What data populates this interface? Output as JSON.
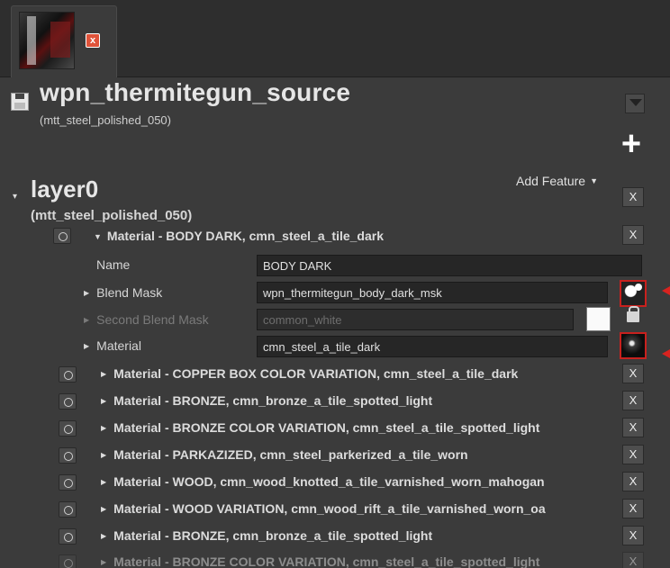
{
  "tab": {
    "close": "x"
  },
  "source": {
    "title": "wpn_thermitegun_source",
    "subtitle": "(mtt_steel_polished_050)",
    "add": "+"
  },
  "layer": {
    "title": "layer0",
    "subtitle": "(mtt_steel_polished_050)",
    "add_feature": "Add Feature",
    "close": "X"
  },
  "material_open": {
    "header": "Material - BODY DARK, cmn_steel_a_tile_dark",
    "close": "X",
    "props": {
      "name_label": "Name",
      "name_value": "BODY DARK",
      "blend_mask_label": "Blend Mask",
      "blend_mask_value": "wpn_thermitegun_body_dark_msk",
      "second_blend_mask_label": "Second Blend Mask",
      "second_blend_mask_value": "common_white",
      "material_label": "Material",
      "material_value": "cmn_steel_a_tile_dark"
    }
  },
  "materials": [
    {
      "label": "Material - COPPER BOX COLOR VARIATION, cmn_steel_a_tile_dark",
      "close": "X"
    },
    {
      "label": "Material - BRONZE, cmn_bronze_a_tile_spotted_light",
      "close": "X"
    },
    {
      "label": "Material - BRONZE COLOR VARIATION, cmn_steel_a_tile_spotted_light",
      "close": "X"
    },
    {
      "label": "Material - PARKAZIZED, cmn_steel_parkerized_a_tile_worn",
      "close": "X"
    },
    {
      "label": "Material - WOOD, cmn_wood_knotted_a_tile_varnished_worn_mahogan",
      "close": "X"
    },
    {
      "label": "Material - WOOD VARIATION, cmn_wood_rift_a_tile_varnished_worn_oa",
      "close": "X"
    },
    {
      "label": "Material - BRONZE, cmn_bronze_a_tile_spotted_light",
      "close": "X"
    },
    {
      "label": "Material - BRONZE COLOR VARIATION, cmn_steel_a_tile_spotted_light",
      "close": "X"
    }
  ],
  "colors": {
    "highlight": "#d8231f",
    "close_tab": "#e0533a"
  }
}
